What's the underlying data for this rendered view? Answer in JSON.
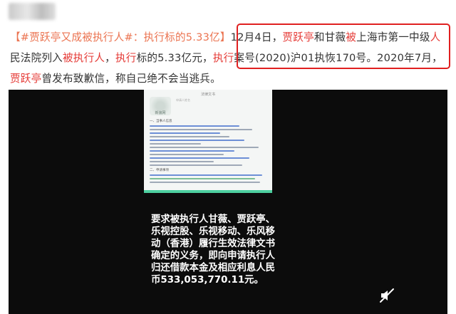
{
  "post": {
    "hashtag": "【#贾跃亭又成被执行人#：执行标的5.33亿】",
    "date": "12月4日，",
    "name1": "贾跃亭",
    "mid1": "和甘薇",
    "bei1": "被",
    "mid2": "上海市第一中级",
    "ren1": "人",
    "mid3": "民法院列入",
    "bei2": "被执",
    "hang1": "行人",
    "comma1": "，",
    "zhixing1": "执行",
    "mid4": "标的5.33亿元，",
    "zhixing2": "执行",
    "mid5": "案号(2020)沪01执恢170号。2020年7月，",
    "name2": "贾跃亭",
    "tail": "曾发布致歉信，称自己绝不会当逃兵。"
  },
  "video": {
    "doc_header": "法律文书",
    "doc_subheader": "申请人姓名",
    "doc_watermark": "新浪网",
    "doc_section1": "一、当事人信息",
    "doc_section2": "二、申请事项",
    "subtitle": "要求被执行人甘薇、贾跃亭、乐视控股、乐视移动、乐风移动（香港）履行生效法律文书确定的义务，即向申请执行人归还借款本金及相应利息人民币533,053,770.11元。"
  },
  "colors": {
    "highlight": "#e53935",
    "link": "#eb7350",
    "box": "#e02020"
  }
}
